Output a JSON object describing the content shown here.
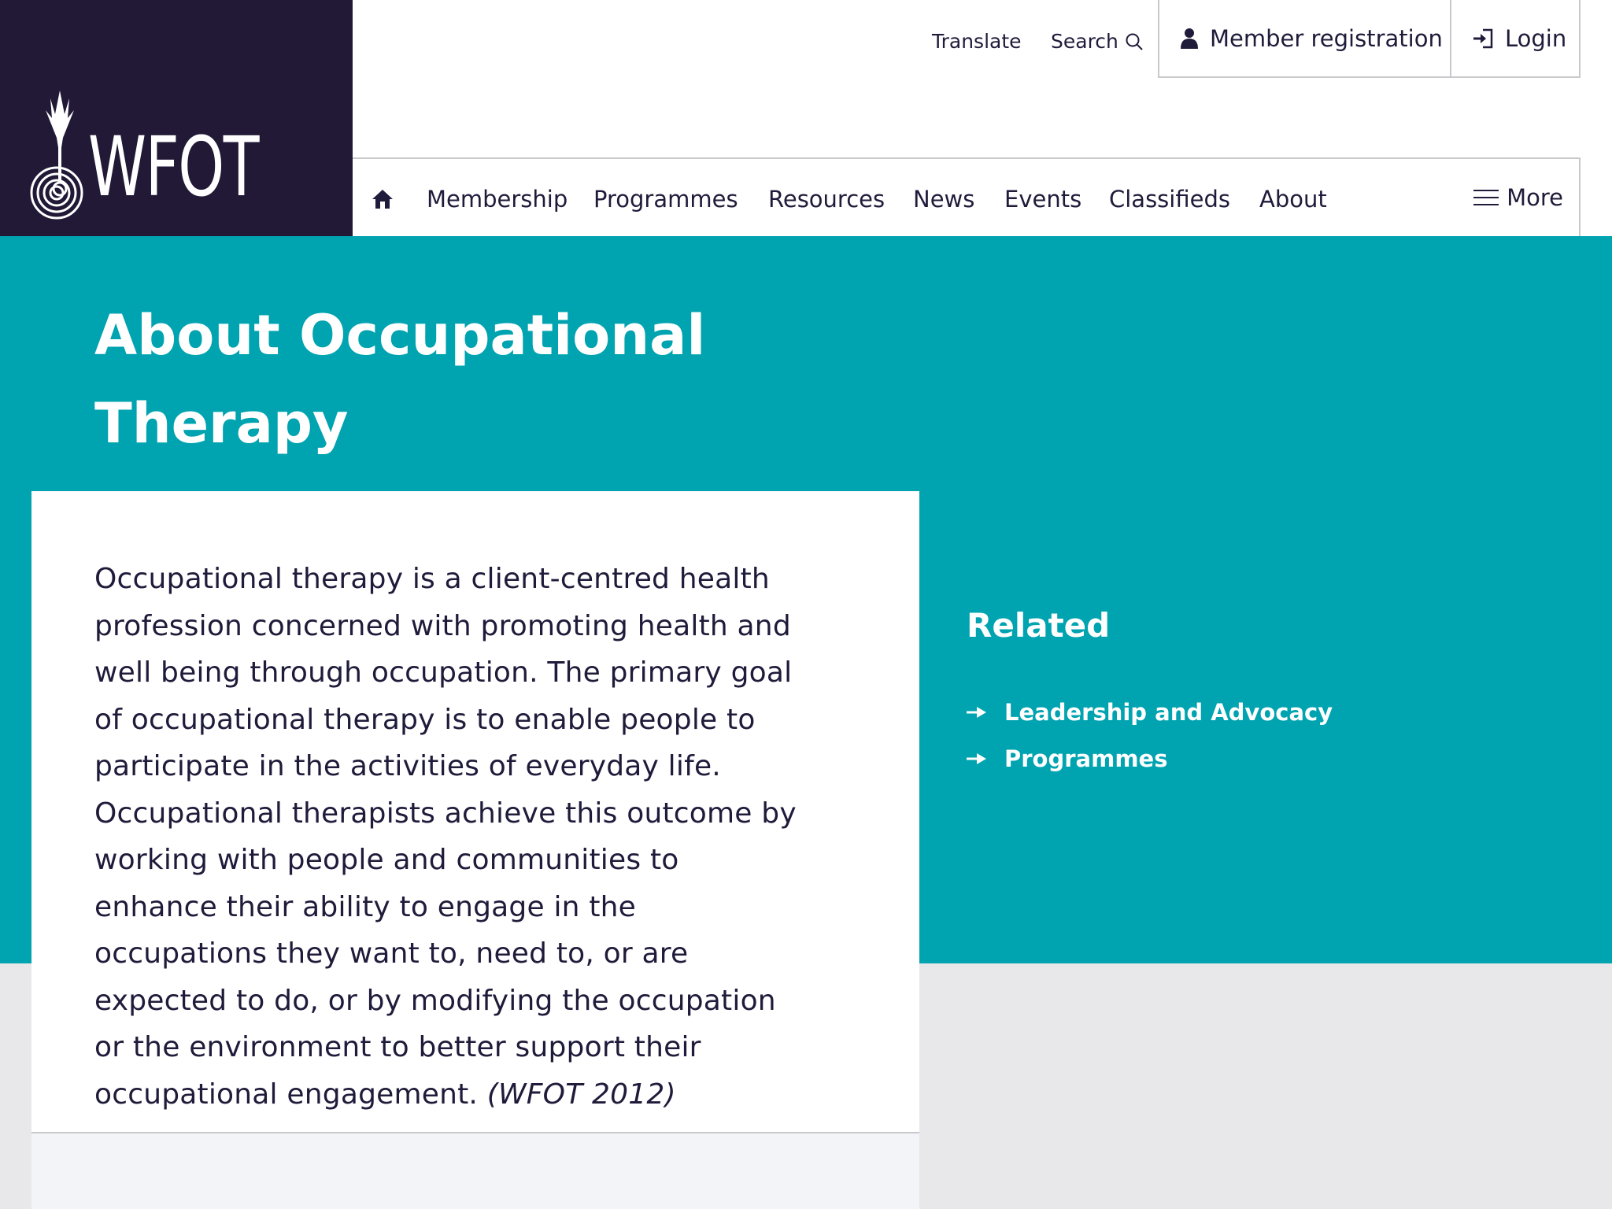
{
  "brand": {
    "logo_text": "WFOT",
    "logo_bg": "#211936"
  },
  "utility": {
    "translate": "Translate",
    "search": "Search",
    "member_registration": "Member registration",
    "login": "Login"
  },
  "nav": {
    "items": [
      "Membership",
      "Programmes",
      "Resources",
      "News",
      "Events",
      "Classifieds",
      "About"
    ],
    "more": "More"
  },
  "page": {
    "title": "About Occupational Therapy",
    "body": "Occupational therapy is a client-centred health profession concerned with promoting health and well being through occupation. The primary goal of occupational therapy is to enable people to participate in the activities of everyday life. Occupational therapists achieve this outcome by working with people and communities to enhance their ability to engage in the occupations they want to, need to, or are expected to do, or by modifying the occupation or the environment to better support their occupational engagement.",
    "citation": "(WFOT 2012)"
  },
  "related": {
    "title": "Related",
    "items": [
      "Leadership and Advocacy",
      "Programmes"
    ]
  },
  "colors": {
    "accent": "#00a3b0",
    "text": "#1f1b3a",
    "page_bg": "#e8e8ea"
  }
}
